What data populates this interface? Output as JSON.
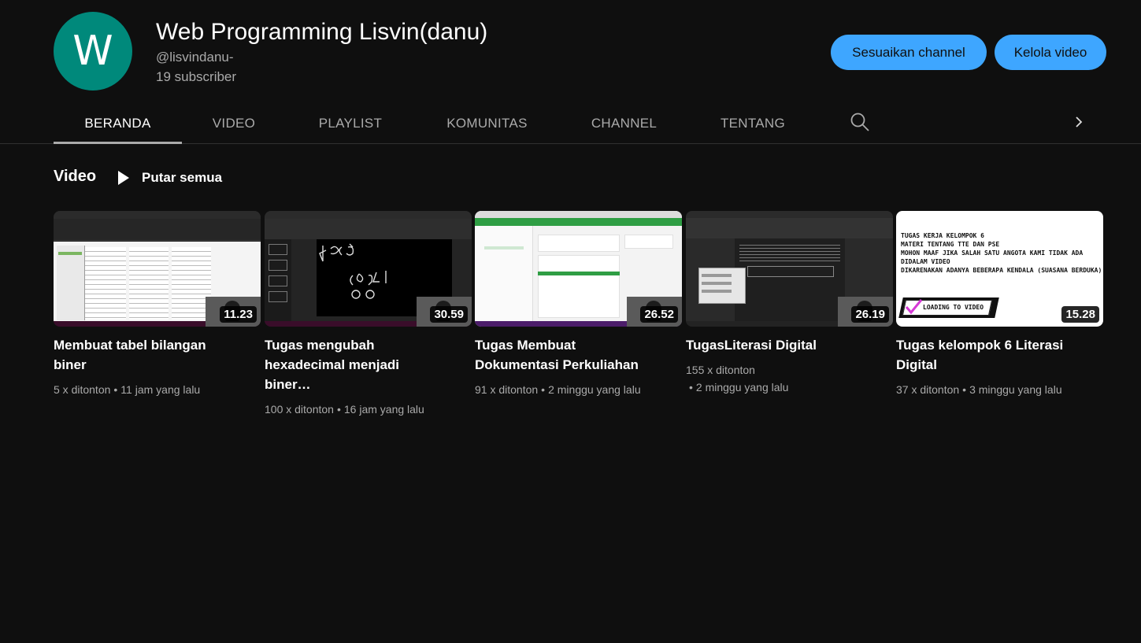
{
  "channel": {
    "avatar_letter": "W",
    "name": "Web Programming Lisvin(danu)",
    "handle": "@lisvindanu-",
    "subscribers": "19 subscriber",
    "avatar_color": "#00897b"
  },
  "actions": {
    "customize_label": "Sesuaikan channel",
    "manage_label": "Kelola video",
    "accent": "#3ea6ff"
  },
  "tabs": [
    {
      "label": "BERANDA",
      "active": true
    },
    {
      "label": "VIDEO",
      "active": false
    },
    {
      "label": "PLAYLIST",
      "active": false
    },
    {
      "label": "KOMUNITAS",
      "active": false
    },
    {
      "label": "CHANNEL",
      "active": false
    },
    {
      "label": "TENTANG",
      "active": false
    }
  ],
  "section": {
    "title": "Video",
    "play_all_label": "Putar semua"
  },
  "videos": [
    {
      "title": "Membuat tabel bilangan biner",
      "duration": "11.23",
      "views": "5 x ditonton",
      "age": "11 jam yang lalu"
    },
    {
      "title": "Tugas mengubah hexadecimal menjadi biner…",
      "duration": "30.59",
      "views": "100 x ditonton",
      "age": "16 jam yang lalu"
    },
    {
      "title": "Tugas Membuat Dokumentasi Perkuliahan",
      "duration": "26.52",
      "views": "91 x ditonton",
      "age": "2 minggu yang lalu"
    },
    {
      "title": "TugasLiterasi Digital",
      "duration": "26.19",
      "views": "155 x ditonton",
      "age": "2 minggu yang lalu"
    },
    {
      "title": "Tugas kelompok 6 Literasi Digital",
      "duration": "15.28",
      "views": "37 x ditonton",
      "age": "3 minggu yang lalu",
      "thumb_text": {
        "line1": "TUGAS KERJA KELOMPOK 6",
        "line2": "MATERI TENTANG TTE DAN PSE",
        "line3": "MOHON MAAF JIKA SALAH SATU ANGOTA KAMI TIDAK ADA DIDALAM VIDEO",
        "line4": "DIKARENAKAN ADANYA BEBERAPA KENDALA (SUASANA BERDUKA)",
        "banner": "LOADING TO VIDEO"
      }
    }
  ]
}
